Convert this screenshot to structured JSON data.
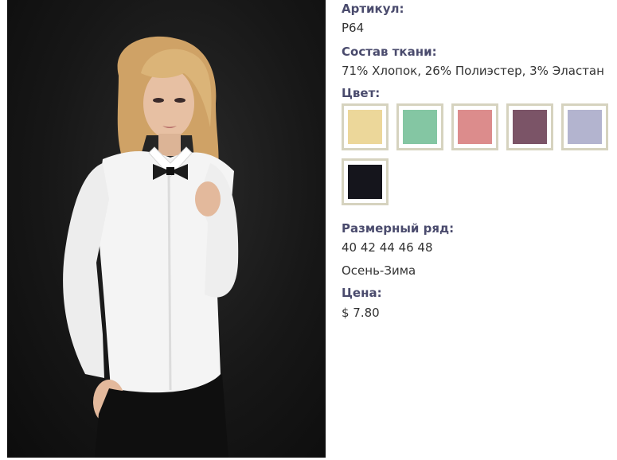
{
  "product": {
    "article_label": "Артикул:",
    "article_value": "P64",
    "fabric_label": "Состав ткани:",
    "fabric_value": "71% Хлопок, 26% Полиэстер, 3% Эластан",
    "color_label": "Цвет:",
    "colors": [
      {
        "name": "yellow",
        "hex": "#ecd79a"
      },
      {
        "name": "mint",
        "hex": "#84c6a3"
      },
      {
        "name": "pink",
        "hex": "#dc8c8c"
      },
      {
        "name": "mauve",
        "hex": "#7b5467"
      },
      {
        "name": "lavender",
        "hex": "#b3b4cf"
      },
      {
        "name": "black",
        "hex": "#15151c"
      }
    ],
    "size_label": "Размерный ряд:",
    "size_value": "40 42 44 46 48",
    "season": "Осень-Зима",
    "price_label": "Цена:",
    "price_value": "$ 7.80"
  },
  "palette": {
    "label_color": "#4a4b6d",
    "swatch_border": "#d6d3bf",
    "shirt": "#f4f4f4",
    "hair": "#d9b176",
    "skin": "#e7c0a3",
    "background": "#161616"
  }
}
